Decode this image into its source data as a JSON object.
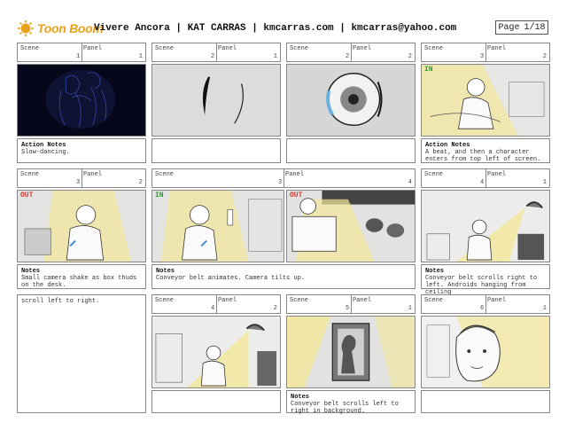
{
  "header": {
    "brand": "Toon Boom",
    "title": "Vivere Ancora | KAT CARRAS | kmcarras.com | kmcarras@yahoo.com",
    "page_label": "Page",
    "page_value": "1/18"
  },
  "labels": {
    "scene": "Scene",
    "panel": "Panel"
  },
  "row1": {
    "c1": {
      "scene": "1",
      "panel": "1",
      "note_title": "Action Notes",
      "note_text": "Slow-dancing."
    },
    "c2": {
      "scene": "2",
      "panel": "1"
    },
    "c3": {
      "scene": "2",
      "panel": "2"
    },
    "c4": {
      "scene": "3",
      "panel": "2",
      "note_title": "Action Notes",
      "note_text": "A beat, and then a character enters from top left of screen."
    }
  },
  "row2": {
    "c1": {
      "scene": "3",
      "panel": "2",
      "note_title": "Notes",
      "note_text": "Small camera shake as box thuds on the desk."
    },
    "c2": {
      "scene": "3",
      "panel": "4",
      "note_title": "Notes",
      "note_text": "Conveyor belt animates. Camera tilts up."
    },
    "c4": {
      "scene": "4",
      "panel": "1",
      "note_title": "Notes",
      "note_text": "Conveyor belt scrolls right to left. Androids hanging from ceiling"
    }
  },
  "row3": {
    "c1": {
      "note_text": "scroll left to right."
    },
    "c2": {
      "scene": "4",
      "panel": "2"
    },
    "c3": {
      "scene": "5",
      "panel": "1",
      "note_title": "Notes",
      "note_text": "Conveyor belt scrolls left to right in background."
    },
    "c4": {
      "scene": "6",
      "panel": "1"
    }
  },
  "marks": {
    "in": "IN",
    "out": "OUT"
  },
  "colors": {
    "brand": "#e6a21a",
    "in_mark": "#2e9a2e",
    "out_mark": "#d9352a",
    "light": "#f3e79a"
  }
}
